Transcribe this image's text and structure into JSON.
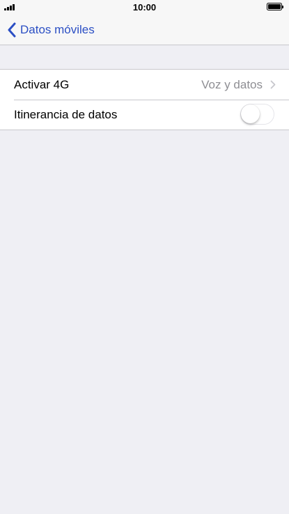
{
  "status_bar": {
    "time": "10:00",
    "signal_icon": "signal-bars-icon",
    "battery_icon": "battery-icon",
    "battery_level": 1.0
  },
  "nav": {
    "back_label": "Datos móviles",
    "back_icon": "chevron-left-icon"
  },
  "settings": {
    "rows": [
      {
        "label": "Activar 4G",
        "value": "Voz y datos",
        "accessory_icon": "chevron-right-icon"
      },
      {
        "label": "Itinerancia de datos",
        "toggle_on": false
      }
    ]
  },
  "colors": {
    "accent": "#2b4fc4",
    "background": "#efeff4",
    "secondary_text": "#8e8e93",
    "separator": "#c8c7cc"
  }
}
